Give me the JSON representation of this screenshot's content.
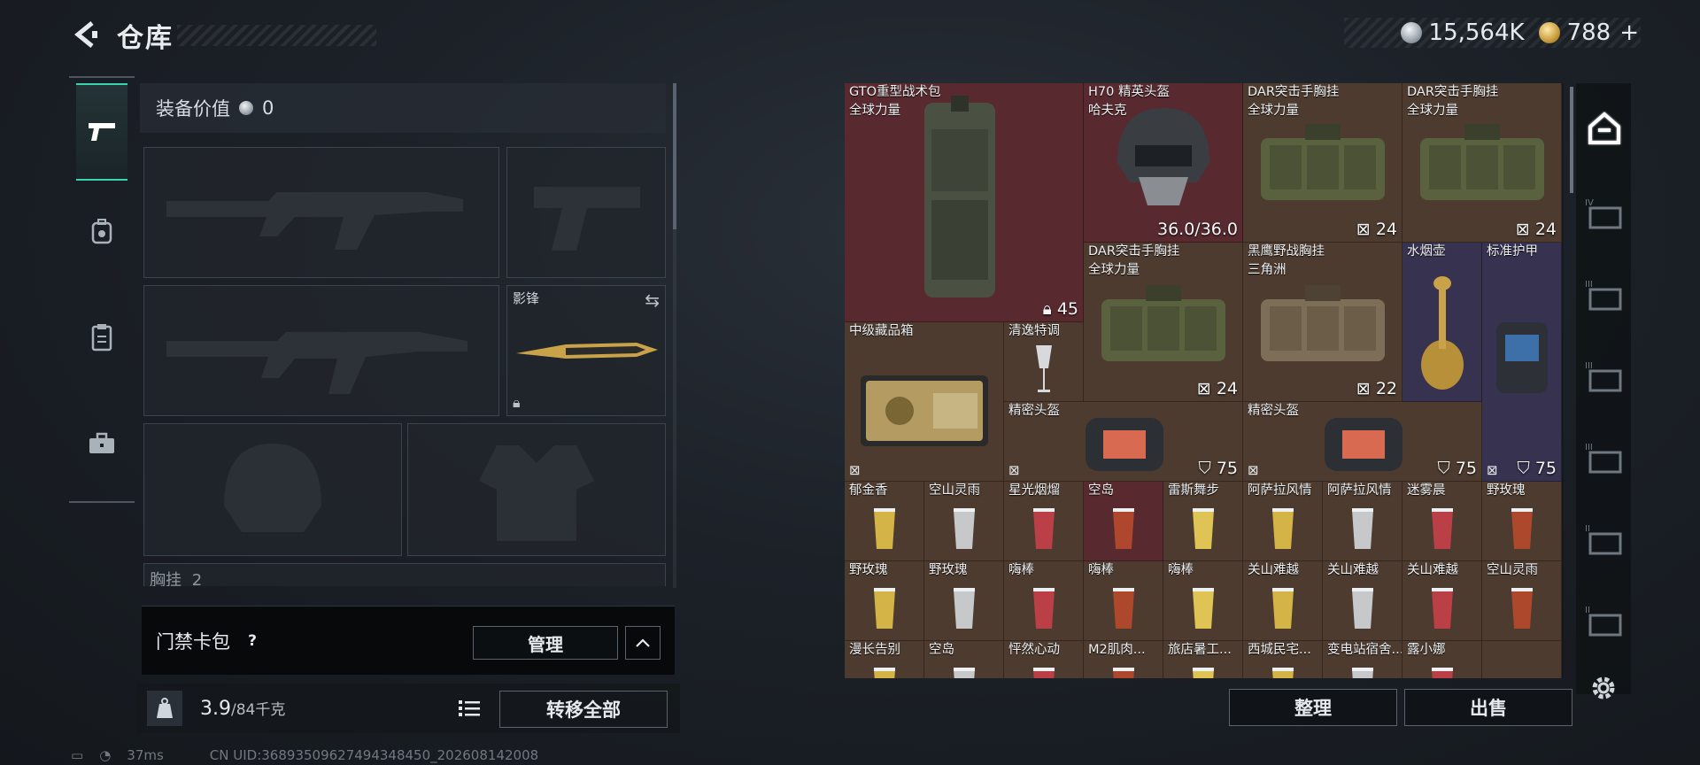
{
  "header": {
    "title": "仓库",
    "silver_amount": "15,564K",
    "gold_amount": "788",
    "back_icon": "back-arrow-icon",
    "plus_icon": "plus-icon"
  },
  "left_tabs": [
    {
      "name": "firearms",
      "icon": "pistol-icon",
      "active": true
    },
    {
      "name": "backpack",
      "icon": "backpack-icon",
      "active": false
    },
    {
      "name": "vest",
      "icon": "clipboard-icon",
      "active": false
    },
    {
      "name": "case",
      "icon": "briefcase-icon",
      "active": false
    }
  ],
  "equipment": {
    "value_label": "装备价值",
    "value": "0",
    "melee_slot_label": "影锋",
    "next_slot_label": "胸挂",
    "next_slot_count": "2"
  },
  "card_pack": {
    "label": "门禁卡包",
    "help": "?",
    "manage_label": "管理"
  },
  "weight": {
    "current": "3.9",
    "max": "/84千克",
    "transfer_all_label": "转移全部"
  },
  "status_bar": {
    "ping": "37ms",
    "uid": "CN UID:36893509627494348450_202608142008"
  },
  "grid_items": [
    {
      "name": "GTO重型战术包",
      "sub": "全球力量",
      "value": "45"
    },
    {
      "name": "H70 精英头盔",
      "sub": "哈夫克",
      "value": "36.0/36.0"
    },
    {
      "name": "DAR突击手胸挂",
      "sub": "全球力量",
      "value": "24"
    },
    {
      "name": "DAR突击手胸挂",
      "sub": "全球力量",
      "value": "24"
    },
    {
      "name": "DAR突击手胸挂",
      "sub": "全球力量",
      "value": "24"
    },
    {
      "name": "黑鹰野战胸挂",
      "sub": "三角洲",
      "value": "22"
    },
    {
      "name": "水烟壶",
      "sub": "",
      "value": ""
    },
    {
      "name": "标准护甲",
      "sub": "",
      "value": "75"
    },
    {
      "name": "中级藏品箱",
      "sub": "",
      "value": ""
    },
    {
      "name": "清逸特调",
      "sub": "",
      "value": ""
    },
    {
      "name": "精密头盔",
      "sub": "",
      "value": "75"
    },
    {
      "name": "精密头盔",
      "sub": "",
      "value": "75"
    }
  ],
  "small_items_row1": [
    "郁金香",
    "空山灵雨",
    "星光烟熘",
    "空岛",
    "雷斯舞步",
    "阿萨拉风情",
    "阿萨拉风情",
    "迷雾晨",
    "野玫瑰"
  ],
  "small_items_row2": [
    "野玫瑰",
    "野玫瑰",
    "嗨棒",
    "嗨棒",
    "嗨棒",
    "关山难越",
    "关山难越",
    "关山难越",
    "空山灵雨"
  ],
  "small_items_row3": [
    "漫长告别",
    "空岛",
    "怦然心动",
    "M2肌肉...",
    "旅店暑工...",
    "西城民宅...",
    "变电站宿舍...",
    "露小娜",
    ""
  ],
  "grid_actions": {
    "sort_label": "整理",
    "sell_label": "出售"
  },
  "right_tabs": [
    {
      "name": "all",
      "icon": "home-shelf-icon"
    },
    {
      "name": "shelf-iv-1",
      "icon": "shelf-iv-icon"
    },
    {
      "name": "shelf-iii-1",
      "icon": "shelf-iii-icon"
    },
    {
      "name": "shelf-iii-2",
      "icon": "shelf-iii-icon"
    },
    {
      "name": "shelf-iii-3",
      "icon": "shelf-iii-icon"
    },
    {
      "name": "shelf-ii-1",
      "icon": "shelf-ii-icon"
    },
    {
      "name": "shelf-ii-2",
      "icon": "shelf-ii-icon"
    }
  ],
  "colors": {
    "accent": "#38d4b0",
    "cell_red": "#582a2f",
    "cell_brown": "#4d3b2f",
    "cell_purple": "#37324f"
  }
}
